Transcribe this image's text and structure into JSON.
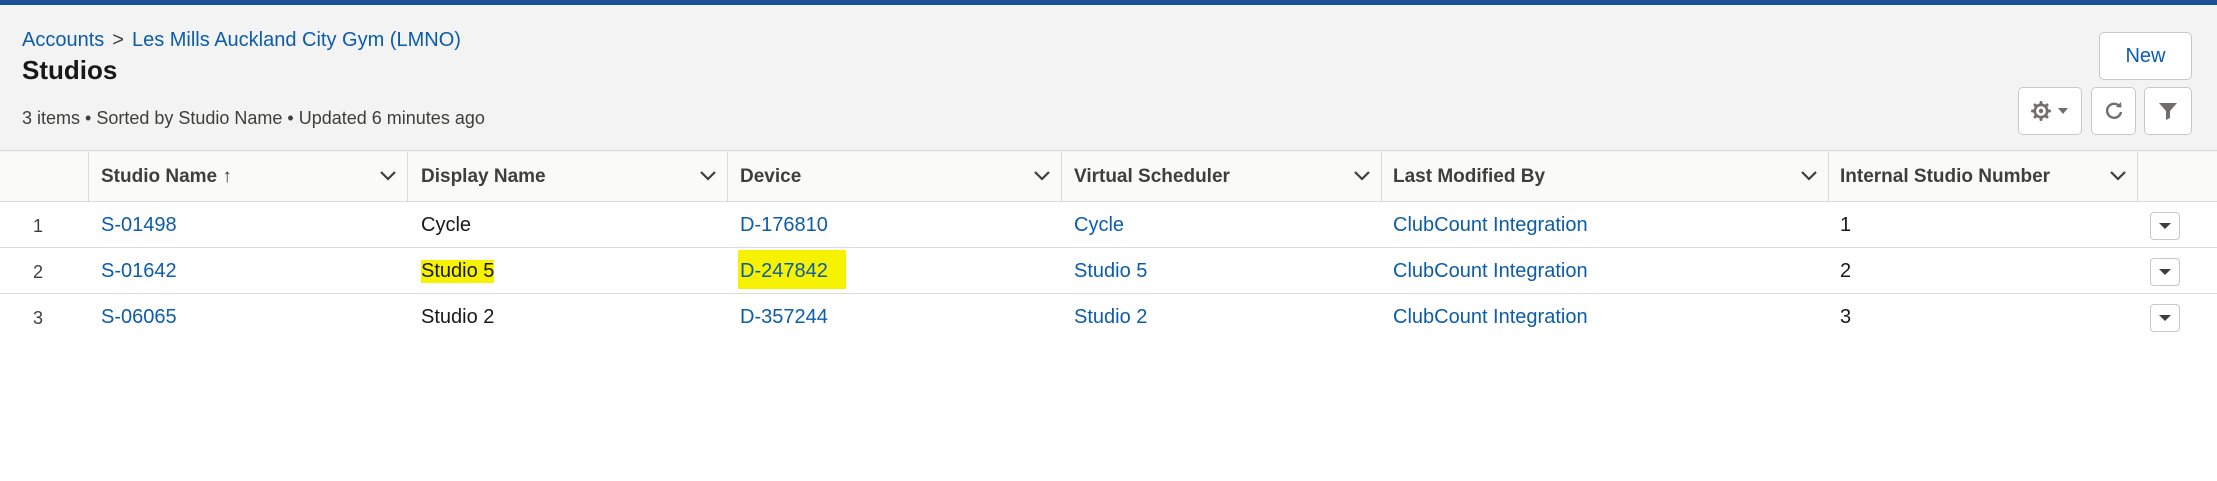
{
  "breadcrumb": {
    "parent": "Accounts",
    "separator": ">",
    "account": "Les Mills Auckland City Gym (LMNO)"
  },
  "page_title": "Studios",
  "summary": "3 items • Sorted by Studio Name • Updated 6 minutes ago",
  "buttons": {
    "new_label": "New"
  },
  "columns": [
    "Studio Name ↑",
    "Display Name",
    "Device",
    "Virtual Scheduler",
    "Last Modified By",
    "Internal Studio Number"
  ],
  "rows": [
    {
      "num": "1",
      "studio": "S-01498",
      "display": "Cycle",
      "device": "D-176810",
      "scheduler": "Cycle",
      "modified_by": "ClubCount Integration",
      "internal": "1"
    },
    {
      "num": "2",
      "studio": "S-01642",
      "display": "Studio 5",
      "device": "D-247842",
      "scheduler": "Studio 5",
      "modified_by": "ClubCount Integration",
      "internal": "2"
    },
    {
      "num": "3",
      "studio": "S-06065",
      "display": "Studio 2",
      "device": "D-357244",
      "scheduler": "Studio 2",
      "modified_by": "ClubCount Integration",
      "internal": "3"
    }
  ],
  "colors": {
    "link": "#0b5cab",
    "highlight": "#f6f200",
    "topbar": "#1b5297"
  },
  "icons": [
    "gear-icon",
    "refresh-icon",
    "filter-icon",
    "chevron-down-icon"
  ]
}
